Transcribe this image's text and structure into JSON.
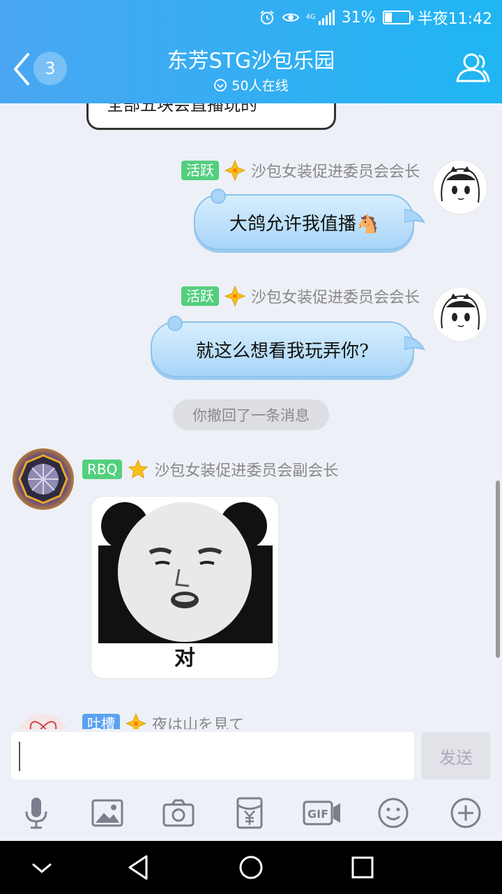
{
  "status_bar": {
    "network_type": "4G",
    "battery_level": "31%",
    "battery_fraction": 0.31,
    "time": "半夜11:42"
  },
  "header": {
    "unread_count": "3",
    "group_name": "东芳STG沙包乐园",
    "online_count": "50人在线"
  },
  "chat": {
    "prev_message_fragment": "全部五块会直播玩的",
    "messages": [
      {
        "level_tag": "活跃",
        "title": "沙包女装促进委员会会长",
        "text": "大鸽允许我值播🐴"
      },
      {
        "level_tag": "活跃",
        "title": "沙包女装促进委员会会长",
        "text": "就这么想看我玩弄你?"
      }
    ],
    "system_notice": "你撤回了一条消息",
    "sticker_message": {
      "level_tag": "RBQ",
      "title": "沙包女装促进委员会副会长",
      "caption": "对"
    },
    "partial_message": {
      "level_tag": "吐槽",
      "title": "夜は山を見て"
    }
  },
  "composer": {
    "input_value": "",
    "send_label": "发送"
  },
  "colors": {
    "header_start": "#4aa6f3",
    "header_end": "#1fb6f3",
    "tag_active": "#53cf7e",
    "tag_rbq": "#53cf7e",
    "tag_tucao": "#5aa2f0",
    "bubble": "#a8d5f8"
  },
  "toolbar_icons": [
    "microphone-icon",
    "image-icon",
    "camera-icon",
    "red-packet-icon",
    "gif-icon",
    "emoji-icon",
    "plus-icon"
  ]
}
